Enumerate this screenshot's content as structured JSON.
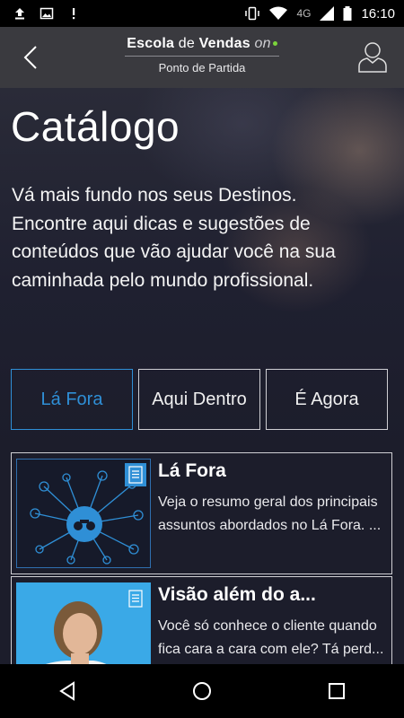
{
  "status_bar": {
    "left_icons": [
      "upload-icon",
      "image-icon",
      "alert-icon"
    ],
    "network": "4G",
    "time": "16:10"
  },
  "header": {
    "brand_bold": "Escola",
    "brand_light": "de",
    "brand_bold2": "Vendas",
    "brand_on": "on",
    "subtitle": "Ponto de Partida",
    "accent": "#7bd43b"
  },
  "hero": {
    "title": "Catálogo",
    "description": "Vá mais fundo nos seus Destinos. Encontre aqui dicas e sugestões de conteúdos que vão ajudar você na sua caminhada pelo mundo profissional."
  },
  "tabs": [
    {
      "label": "Lá Fora",
      "active": true
    },
    {
      "label": "Aqui Dentro",
      "active": false
    },
    {
      "label": "É Agora",
      "active": false
    }
  ],
  "cards": [
    {
      "title": "Lá Fora",
      "text": "Veja o resumo geral dos principais assuntos abordados no Lá Fora. ..."
    },
    {
      "title": "Visão além do a...",
      "text": "Você só conhece o cliente quando fica cara a cara com ele? Tá perd..."
    }
  ],
  "colors": {
    "accent_blue": "#2f8fd6",
    "appbar": "#3a3a3f",
    "background": "#1c1d2b"
  }
}
